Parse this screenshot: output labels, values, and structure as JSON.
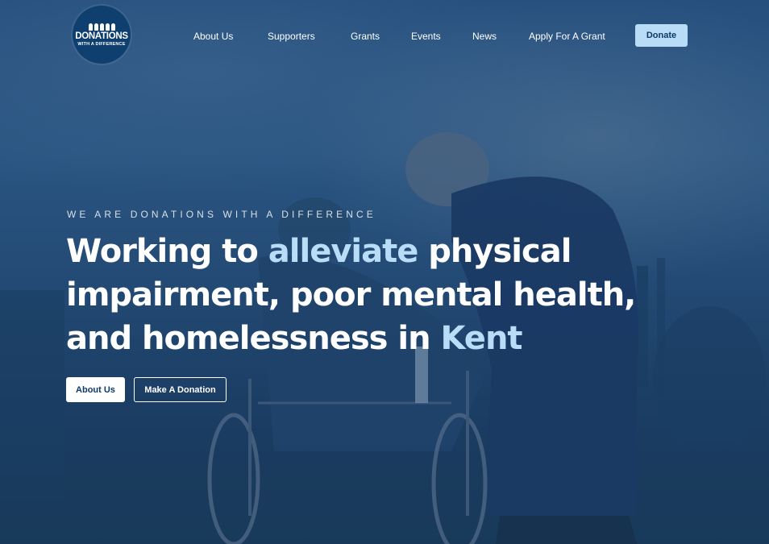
{
  "logo": {
    "main_line": "DONATIONS",
    "sub_line": "WITH A DIFFERENCE"
  },
  "nav": {
    "items": [
      "About Us",
      "Supporters",
      "Grants",
      "Events",
      "News",
      "Apply For A Grant"
    ],
    "donate_label": "Donate"
  },
  "hero": {
    "eyebrow": "WE ARE DONATIONS WITH A DIFFERENCE",
    "headline": {
      "part1": "Working to ",
      "accent1": "alleviate",
      "part2": " physical impairment, poor mental health, and homelessness in ",
      "accent2": "Kent"
    },
    "buttons": {
      "about_label": "About Us",
      "donation_label": "Make A Donation"
    },
    "background_image": "person-helping-wheelchair-user-outdoors"
  },
  "colors": {
    "overlay": "#1f4a78",
    "accent": "#b9dcf7",
    "button_text": "#0b3a68",
    "logo_bg": "#0f3f6f"
  }
}
